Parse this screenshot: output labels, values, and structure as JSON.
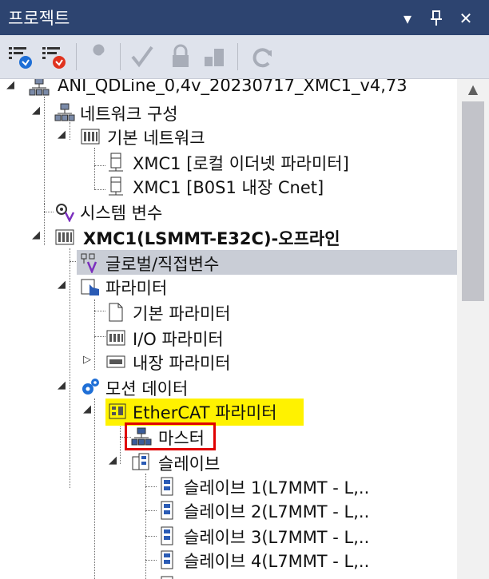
{
  "panel": {
    "title": "프로젝트",
    "controls": {
      "dropdown": "▾",
      "pin": "ᵖ",
      "close": "✕"
    }
  },
  "toolbar": {
    "icons": [
      "filter-blue-icon",
      "filter-red-icon",
      "wrench-icon",
      "check-icon",
      "lock-icon",
      "network-export-icon",
      "refresh-icon"
    ]
  },
  "tree": {
    "items": [
      {
        "label": "ANI_QDLine_0,4v_20230717_XMC1_v4,73",
        "icon": "project-network-icon",
        "expander": "◢"
      },
      {
        "label": "네트워크 구성",
        "icon": "network-config-icon",
        "expander": "◢"
      },
      {
        "label": "기본 네트워크",
        "icon": "basic-network-icon",
        "expander": "◢"
      },
      {
        "label": "XMC1 [로컬 이더넷 파라미터]",
        "icon": "device-icon"
      },
      {
        "label": "XMC1 [B0S1 내장 Cnet]",
        "icon": "device-icon"
      },
      {
        "label": "시스템 변수",
        "icon": "system-variable-icon"
      },
      {
        "label": "XMC1(LSMMT-E32C)-오프라인",
        "icon": "plc-icon",
        "expander": "◢"
      },
      {
        "label": "글로벌/직접변수",
        "icon": "global-variable-icon"
      },
      {
        "label": "파라미터",
        "icon": "parameter-icon",
        "expander": "◢"
      },
      {
        "label": "기본 파라미터",
        "icon": "document-icon"
      },
      {
        "label": "I/O 파라미터",
        "icon": "io-parameter-icon"
      },
      {
        "label": "내장 파라미터",
        "icon": "builtin-parameter-icon",
        "expander": "▷"
      },
      {
        "label": "모션 데이터",
        "icon": "motion-gear-icon",
        "expander": "◢"
      },
      {
        "label": "EtherCAT 파라미터",
        "icon": "ethercat-icon",
        "expander": "◢"
      },
      {
        "label": "마스터",
        "icon": "master-network-icon"
      },
      {
        "label": "슬레이브",
        "icon": "slave-group-icon",
        "expander": "◢"
      },
      {
        "label": "슬레이브  1(L7MMT - L,..",
        "icon": "slave-device-icon"
      },
      {
        "label": "슬레이브  2(L7MMT - L,..",
        "icon": "slave-device-icon"
      },
      {
        "label": "슬레이브  3(L7MMT - L,..",
        "icon": "slave-device-icon"
      },
      {
        "label": "슬레이브  4(L7MMT - L,..",
        "icon": "slave-device-icon"
      }
    ]
  },
  "colors": {
    "titlebar": "#2d4470",
    "highlight_yellow": "#fff200",
    "selection_box": "#e00000",
    "selected_row": "#c9cdd6"
  }
}
